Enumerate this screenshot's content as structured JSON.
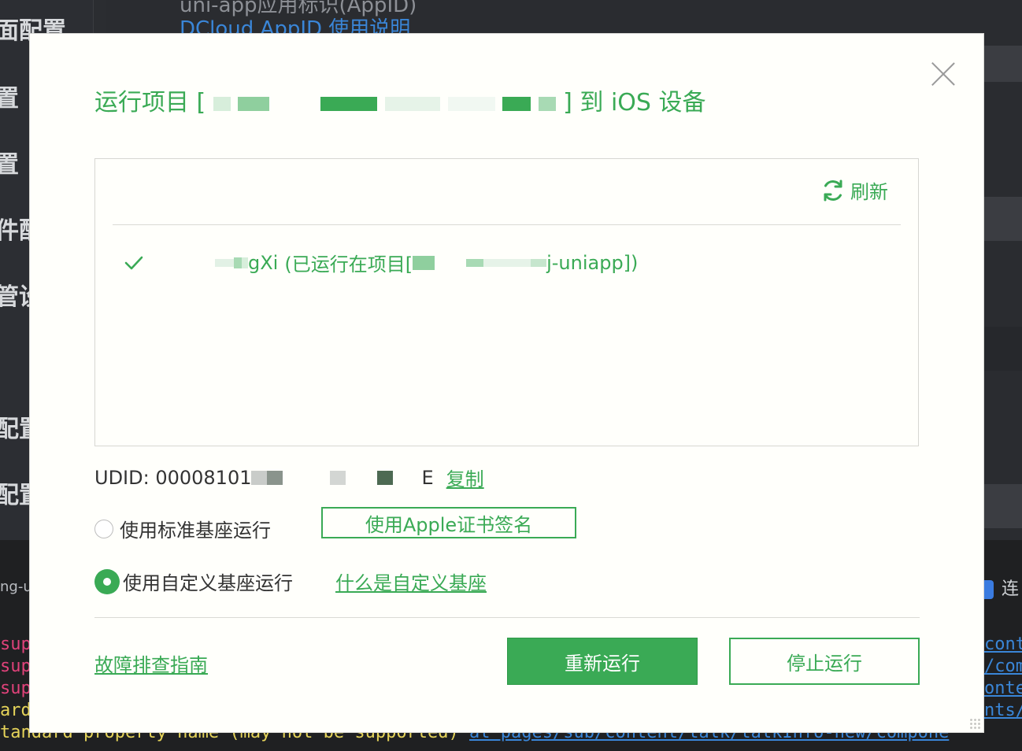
{
  "background": {
    "sidebar_items": [
      "面配置",
      "置",
      "置",
      "件配",
      "管设",
      "配置",
      "配置"
    ],
    "top_text_line1": "uni-app应用标识(AppID)",
    "top_text_line2": "DCloud AppID 使用说明",
    "console_tab": "ng-u",
    "console_right": "连",
    "log_lines": [
      {
        "text": "sup",
        "right": "cont"
      },
      {
        "text": "sup",
        "right": "/com"
      },
      {
        "text": "sup",
        "right": "onte"
      },
      {
        "text": "ard",
        "right": "nts/"
      },
      {
        "text": "tandard property name (may not be supported)",
        "link": "at pages/sub/content/talk/talkInfo-new/compone"
      }
    ]
  },
  "dialog": {
    "title_prefix": "运行项目 [",
    "title_suffix": "] 到 iOS 设备",
    "refresh_label": "刷新",
    "device": {
      "name_visible": "gXi",
      "status_prefix": "(已运行在项目[",
      "status_suffix": "j-uniapp])"
    },
    "udid_label": "UDID: 00008101",
    "udid_tail": "E",
    "copy_label": "复制",
    "radio_standard_label": "使用标准基座运行",
    "radio_custom_label": "使用自定义基座运行",
    "apple_sign_label": "使用Apple证书签名",
    "custom_base_link": "什么是自定义基座",
    "guide_link": "故障排查指南",
    "rerun_label": "重新运行",
    "stop_label": "停止运行",
    "colors": {
      "accent": "#3aaa55",
      "dialog_bg": "#fffffb",
      "ide_bg": "#2b2d31"
    },
    "icons": [
      "close-icon",
      "refresh-icon",
      "check-icon"
    ]
  }
}
